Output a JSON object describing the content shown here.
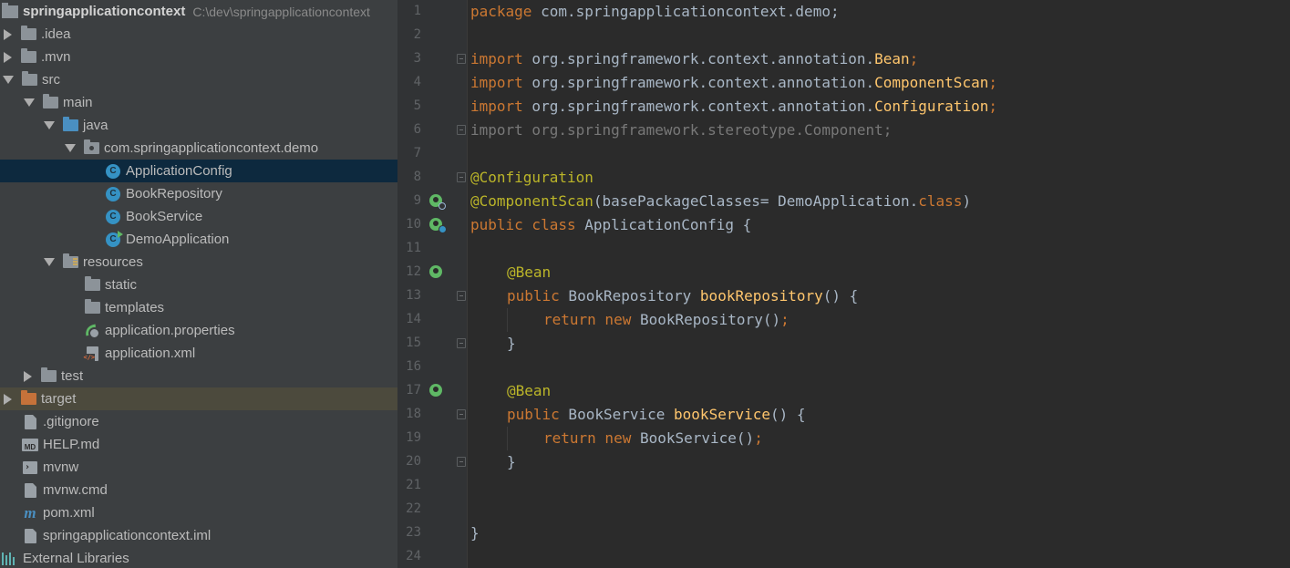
{
  "project_tree": {
    "root": {
      "name": "springapplicationcontext",
      "path": "C:\\dev\\springapplicationcontext"
    },
    "items": [
      {
        "label": ".idea"
      },
      {
        "label": ".mvn"
      },
      {
        "label": "src"
      },
      {
        "label": "main"
      },
      {
        "label": "java"
      },
      {
        "label": "com.springapplicationcontext.demo"
      },
      {
        "label": "ApplicationConfig"
      },
      {
        "label": "BookRepository"
      },
      {
        "label": "BookService"
      },
      {
        "label": "DemoApplication"
      },
      {
        "label": "resources"
      },
      {
        "label": "static"
      },
      {
        "label": "templates"
      },
      {
        "label": "application.properties"
      },
      {
        "label": "application.xml"
      },
      {
        "label": "test"
      },
      {
        "label": "target"
      },
      {
        "label": ".gitignore"
      },
      {
        "label": "HELP.md"
      },
      {
        "label": "mvnw"
      },
      {
        "label": "mvnw.cmd"
      },
      {
        "label": "pom.xml"
      },
      {
        "label": "springapplicationcontext.iml"
      },
      {
        "label": "External Libraries"
      }
    ],
    "selected": "ApplicationConfig",
    "class_icon_letter": "C",
    "md_icon_text": "MD",
    "maven_icon_text": "m"
  },
  "editor": {
    "line_numbers": [
      "1",
      "2",
      "3",
      "4",
      "5",
      "6",
      "7",
      "8",
      "9",
      "10",
      "11",
      "12",
      "13",
      "14",
      "15",
      "16",
      "17",
      "18",
      "19",
      "20",
      "21",
      "22",
      "23",
      "24"
    ],
    "lines": {
      "l1": {
        "kw": "package",
        "rest": " com.springapplicationcontext.demo;"
      },
      "l3": {
        "kw": "import",
        "pkg": " org.springframework.context.annotation.",
        "cls": "Bean",
        "end": ";"
      },
      "l4": {
        "kw": "import",
        "pkg": " org.springframework.context.annotation.",
        "cls": "ComponentScan",
        "end": ";"
      },
      "l5": {
        "kw": "import",
        "pkg": " org.springframework.context.annotation.",
        "cls": "Configuration",
        "end": ";"
      },
      "l6": {
        "text": "import org.springframework.stereotype.Component;"
      },
      "l8": {
        "ann": "@Configuration"
      },
      "l9": {
        "ann": "@ComponentScan",
        "open": "(",
        "param": "basePackageClasses",
        "eq": "= ",
        "ref": "DemoApplication.",
        "kw": "class",
        "close": ")"
      },
      "l10": {
        "kw": "public class",
        "name": " ApplicationConfig {"
      },
      "l12": {
        "ann": "@Bean"
      },
      "l13": {
        "kw": "public",
        "type": " BookRepository ",
        "fn": "bookRepository",
        "rest": "() {"
      },
      "l14": {
        "kw": "return new",
        "rest": " BookRepository()",
        "end": ";"
      },
      "l15": {
        "text": "}"
      },
      "l17": {
        "ann": "@Bean"
      },
      "l18": {
        "kw": "public",
        "type": " BookService ",
        "fn": "bookService",
        "rest": "() {"
      },
      "l19": {
        "kw": "return new",
        "rest": " BookService()",
        "end": ";"
      },
      "l20": {
        "text": "}"
      },
      "l23": {
        "text": "}"
      }
    }
  },
  "colors": {
    "tree_bg": "#3c3f41",
    "editor_bg": "#2b2b2b",
    "gutter_bg": "#313335",
    "selection": "#0d293e",
    "keyword": "#cc7832",
    "annotation": "#bbb529",
    "method": "#ffc66d",
    "text": "#a9b7c6"
  }
}
